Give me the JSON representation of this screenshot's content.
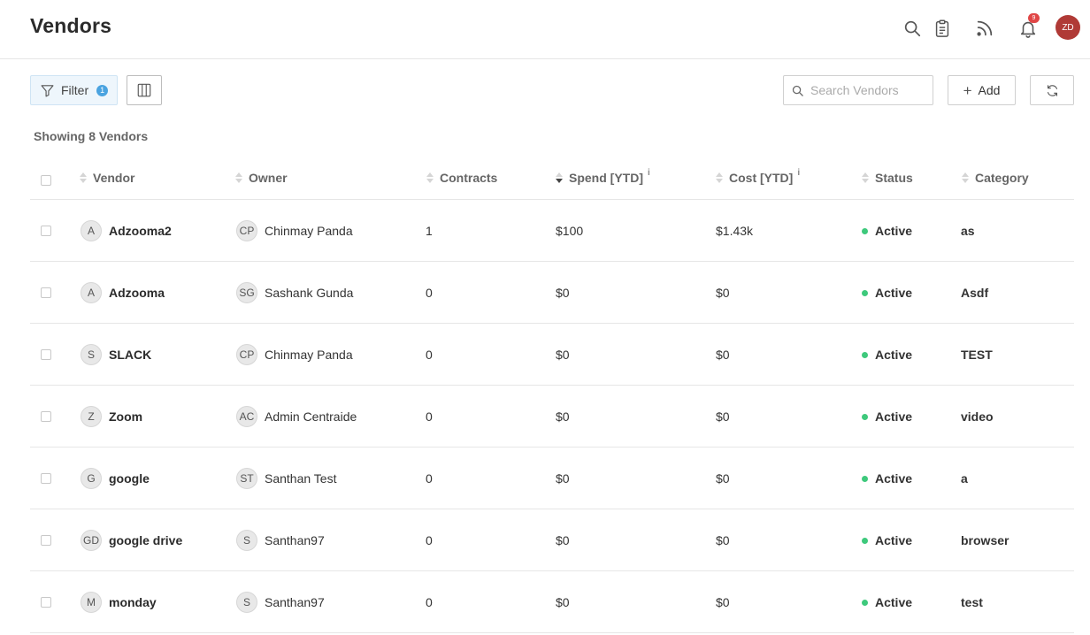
{
  "header": {
    "title": "Vendors",
    "notification_count": "9",
    "user_initials": "ZD",
    "icons": [
      "search-icon",
      "clipboard-icon",
      "rss-icon",
      "bell-icon"
    ]
  },
  "toolbar": {
    "filter_label": "Filter",
    "filter_count": "1",
    "search_placeholder": "Search Vendors",
    "add_label": "Add"
  },
  "summary": "Showing 8 Vendors",
  "columns": [
    "Vendor",
    "Owner",
    "Contracts",
    "Spend [YTD]",
    "Cost [YTD]",
    "Status",
    "Category"
  ],
  "info_marker": "i",
  "status_color": "#3ec97c",
  "rows": [
    {
      "vendor_initials": "A",
      "vendor": "Adzooma2",
      "owner_initials": "CP",
      "owner": "Chinmay Panda",
      "contracts": "1",
      "spend": "$100",
      "cost": "$1.43k",
      "status": "Active",
      "category": "as"
    },
    {
      "vendor_initials": "A",
      "vendor": "Adzooma",
      "owner_initials": "SG",
      "owner": "Sashank Gunda",
      "contracts": "0",
      "spend": "$0",
      "cost": "$0",
      "status": "Active",
      "category": "Asdf"
    },
    {
      "vendor_initials": "S",
      "vendor": "SLACK",
      "owner_initials": "CP",
      "owner": "Chinmay Panda",
      "contracts": "0",
      "spend": "$0",
      "cost": "$0",
      "status": "Active",
      "category": "TEST"
    },
    {
      "vendor_initials": "Z",
      "vendor": "Zoom",
      "owner_initials": "AC",
      "owner": "Admin Centraide",
      "contracts": "0",
      "spend": "$0",
      "cost": "$0",
      "status": "Active",
      "category": "video"
    },
    {
      "vendor_initials": "G",
      "vendor": "google",
      "owner_initials": "ST",
      "owner": "Santhan Test",
      "contracts": "0",
      "spend": "$0",
      "cost": "$0",
      "status": "Active",
      "category": "a"
    },
    {
      "vendor_initials": "GD",
      "vendor": "google drive",
      "owner_initials": "S",
      "owner": "Santhan97",
      "contracts": "0",
      "spend": "$0",
      "cost": "$0",
      "status": "Active",
      "category": "browser"
    },
    {
      "vendor_initials": "M",
      "vendor": "monday",
      "owner_initials": "S",
      "owner": "Santhan97",
      "contracts": "0",
      "spend": "$0",
      "cost": "$0",
      "status": "Active",
      "category": "test"
    }
  ]
}
